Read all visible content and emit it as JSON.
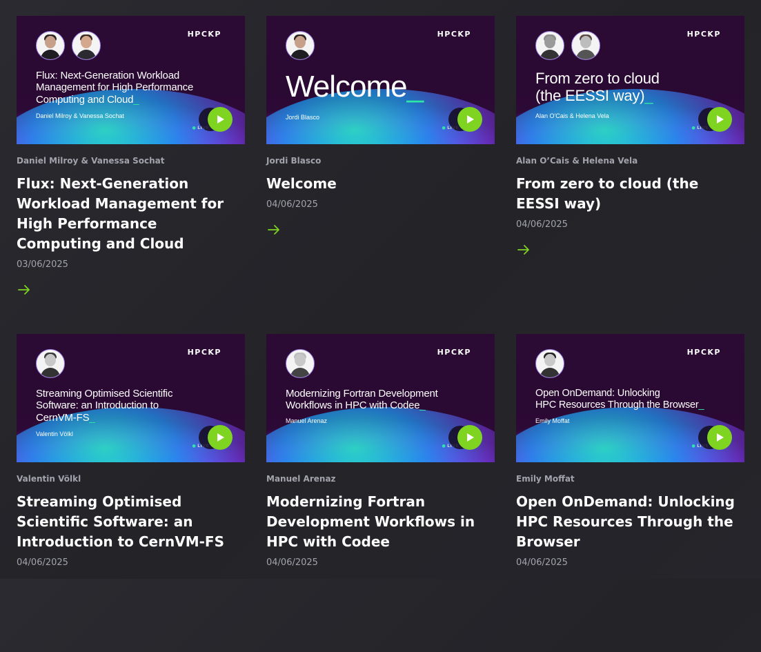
{
  "colors": {
    "accent": "#7fd321",
    "cursor": "#2ee6a8",
    "title": "#ffffff",
    "meta": "#a3a3ad"
  },
  "cards": [
    {
      "brand": "HPCKP",
      "thumb_title_lines": [
        "Flux: Next-Generation Workload",
        "Management for High Performance",
        "Computing and Cloud"
      ],
      "thumb_speaker": "Daniel Milroy & Vanessa Sochat",
      "live": "LIVE",
      "avatars": 2,
      "speaker": "Daniel Milroy & Vanessa Sochat",
      "title": "Flux: Next-Generation Workload Management for High Performance Computing and Cloud",
      "date": "03/06/2025",
      "play_icon": "play-icon",
      "arrow_icon": "arrow-right-icon"
    },
    {
      "brand": "HPCKP",
      "thumb_title_lines": [
        "Welcome"
      ],
      "thumb_speaker": "Jordi Blasco",
      "live": "LIVE",
      "avatars": 1,
      "speaker": "Jordi Blasco",
      "title": "Welcome",
      "date": "04/06/2025",
      "play_icon": "play-icon",
      "arrow_icon": "arrow-right-icon"
    },
    {
      "brand": "HPCKP",
      "thumb_title_lines": [
        "From zero to cloud",
        "(the EESSI way)"
      ],
      "thumb_speaker": "Alan O'Cais & Helena Vela",
      "live": "LIVE",
      "avatars": 2,
      "speaker": "Alan O’Cais & Helena Vela",
      "title": "From zero to cloud (the EESSI way)",
      "date": "04/06/2025",
      "play_icon": "play-icon",
      "arrow_icon": "arrow-right-icon"
    },
    {
      "brand": "HPCKP",
      "thumb_title_lines": [
        "Streaming Optimised Scientific",
        "Software: an Introduction to",
        "CernVM-FS"
      ],
      "thumb_speaker": "Valentin Völkl",
      "live": "LIVE",
      "avatars": 1,
      "speaker": "Valentin Völkl",
      "title": "Streaming Optimised Scientific Software: an Introduction to CernVM-FS",
      "date": "04/06/2025",
      "play_icon": "play-icon",
      "arrow_icon": "arrow-right-icon"
    },
    {
      "brand": "HPCKP",
      "thumb_title_lines": [
        "Modernizing Fortran Development",
        "Workflows in HPC with Codee"
      ],
      "thumb_speaker": "Manuel Arenaz",
      "live": "LIVE",
      "avatars": 1,
      "speaker": "Manuel Arenaz",
      "title": "Modernizing Fortran Development Workflows in HPC with Codee",
      "date": "04/06/2025",
      "play_icon": "play-icon",
      "arrow_icon": "arrow-right-icon"
    },
    {
      "brand": "HPCKP",
      "thumb_title_lines": [
        "Open OnDemand: Unlocking",
        "HPC Resources Through the Browser"
      ],
      "thumb_speaker": "Emily Moffat",
      "live": "LIVE",
      "avatars": 1,
      "speaker": "Emily Moffat",
      "title": "Open OnDemand: Unlocking HPC Resources Through the Browser",
      "date": "04/06/2025",
      "play_icon": "play-icon",
      "arrow_icon": "arrow-right-icon"
    }
  ]
}
